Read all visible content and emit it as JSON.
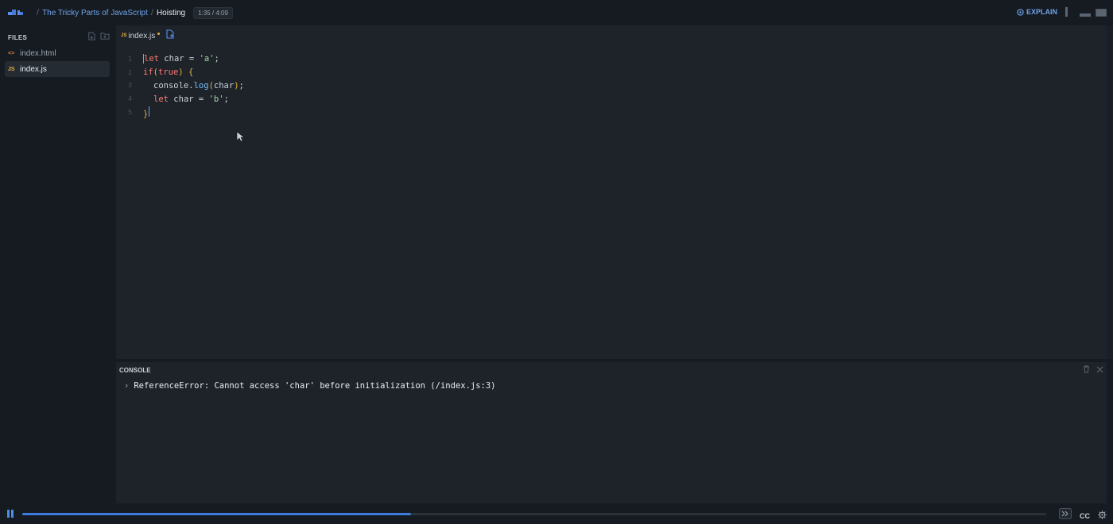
{
  "breadcrumb": {
    "course": "The Tricky Parts of JavaScript",
    "lesson": "Hoisting",
    "timer": "1:35 / 4:09"
  },
  "header": {
    "explain_label": "EXPLAIN"
  },
  "sidebar": {
    "title": "FILES",
    "files": [
      {
        "name": "index.html",
        "icon": "<>"
      },
      {
        "name": "index.js",
        "icon": "JS"
      }
    ]
  },
  "editor": {
    "tab_label": "index.js",
    "tab_icon": "JS",
    "lines": [
      "1",
      "2",
      "3",
      "4",
      "5"
    ]
  },
  "console": {
    "title": "CONSOLE",
    "message": "ReferenceError: Cannot access 'char' before initialization (/index.js:3)"
  },
  "player": {
    "progress": 0.38,
    "cc_label": "CC"
  },
  "colors": {
    "accent": "#3d7de0",
    "background": "#161b22",
    "panel": "#1e2329"
  }
}
